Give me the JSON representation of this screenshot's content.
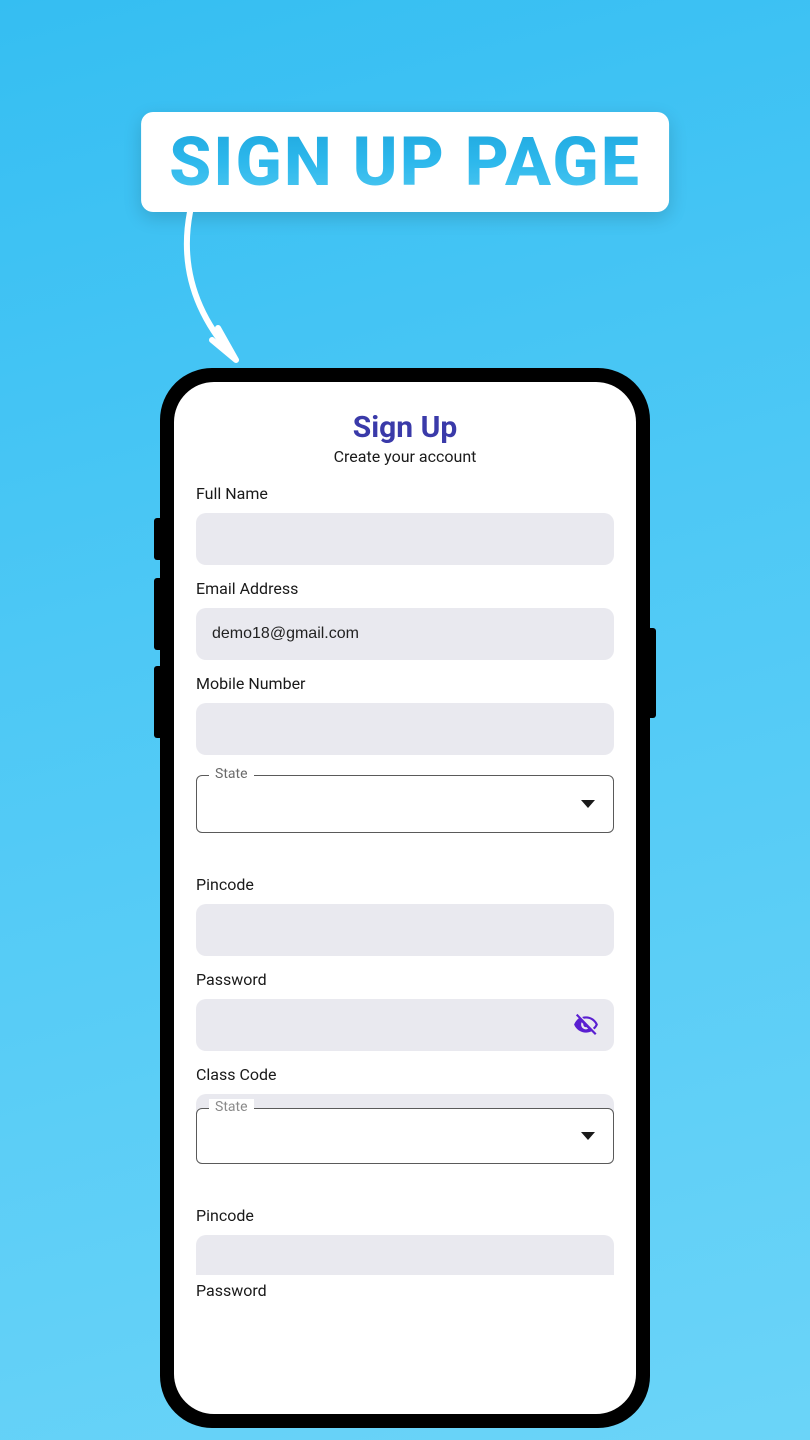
{
  "banner": {
    "title": "SIGN UP PAGE"
  },
  "screen": {
    "title": "Sign Up",
    "subtitle": "Create your account",
    "fields": {
      "fullname": {
        "label": "Full Name",
        "value": ""
      },
      "email": {
        "label": "Email Address",
        "value": "demo18@gmail.com"
      },
      "mobile": {
        "label": "Mobile Number",
        "value": ""
      },
      "state1": {
        "legend": "State",
        "value": ""
      },
      "pincode1": {
        "label": "Pincode",
        "value": ""
      },
      "password1": {
        "label": "Password",
        "value": ""
      },
      "classcode": {
        "label": "Class Code",
        "value": ""
      },
      "state2": {
        "legend": "State",
        "value": ""
      },
      "pincode2": {
        "label": "Pincode",
        "value": ""
      },
      "password2": {
        "label": "Password",
        "value": ""
      }
    }
  }
}
